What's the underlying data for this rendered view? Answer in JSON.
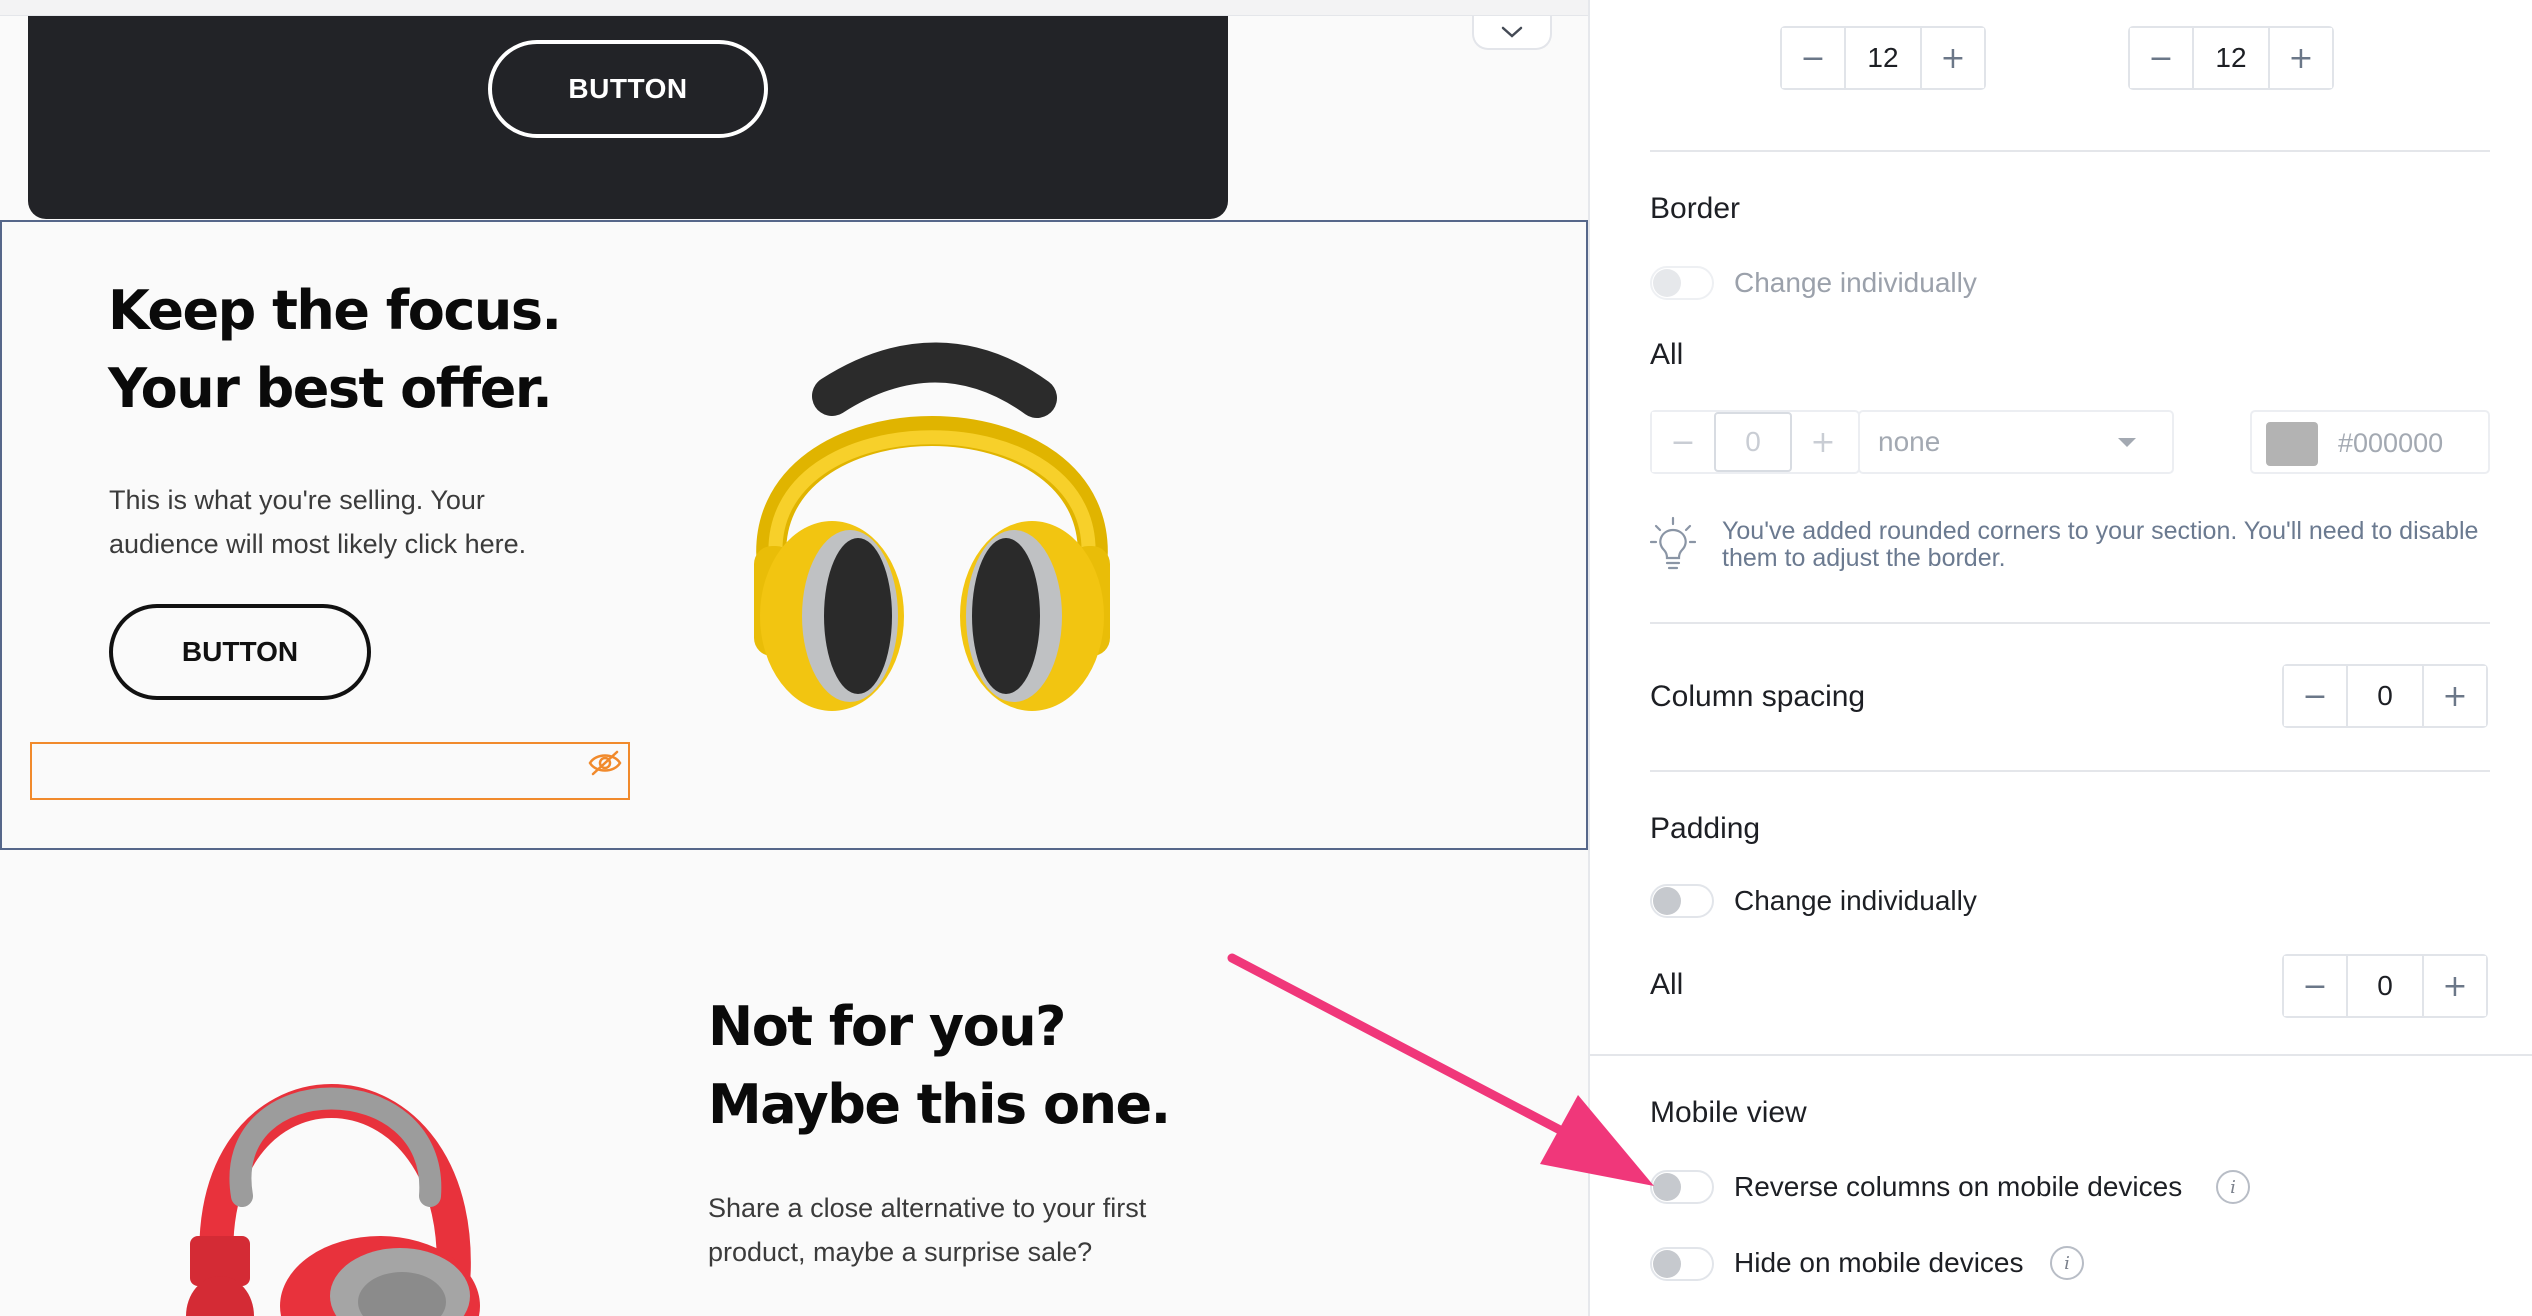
{
  "canvas": {
    "dark_section": {
      "button_label": "BUTTON"
    },
    "selected_section": {
      "headline_line1": "Keep the focus.",
      "headline_line2": "Your best offer.",
      "body_line1": "This is what you're selling. Your",
      "body_line2": "audience will most likely click here.",
      "button_label": "BUTTON",
      "hidden_block_icon": "eye-slash-icon"
    },
    "lower_section": {
      "headline_line1": "Not for you?",
      "headline_line2": "Maybe this one.",
      "body_line1": "Share a close alternative to your first",
      "body_line2": "product, maybe a surprise sale?"
    },
    "colors": {
      "accent_orange": "#f18a2c",
      "selection_border": "#56678a",
      "dark_bg": "#222327",
      "headphones_yellow": "#f2c511",
      "headphones_red": "#e8323c"
    }
  },
  "panel": {
    "top_steppers": [
      {
        "minus": "−",
        "value": "12",
        "plus": "+"
      },
      {
        "minus": "−",
        "value": "12",
        "plus": "+"
      }
    ],
    "border": {
      "title": "Border",
      "change_individually_label": "Change individually",
      "all_label": "All",
      "width": {
        "minus": "−",
        "value": "0",
        "plus": "+"
      },
      "style_value": "none",
      "color_hex": "#000000",
      "swatch_color": "#b3b3b3",
      "hint_line1": "You've added rounded corners to your section. You'll need to disable",
      "hint_line2": "them to adjust the border.",
      "hint_icon": "lightbulb-icon"
    },
    "column_spacing": {
      "label": "Column spacing",
      "stepper": {
        "minus": "−",
        "value": "0",
        "plus": "+"
      }
    },
    "padding": {
      "title": "Padding",
      "change_individually_label": "Change individually",
      "all_label": "All",
      "stepper": {
        "minus": "−",
        "value": "0",
        "plus": "+"
      }
    },
    "mobile_view": {
      "title": "Mobile view",
      "reverse_label": "Reverse columns on mobile devices",
      "hide_label": "Hide on mobile devices",
      "info_glyph": "i"
    }
  },
  "annotation": {
    "arrow_color": "#f0377a"
  }
}
